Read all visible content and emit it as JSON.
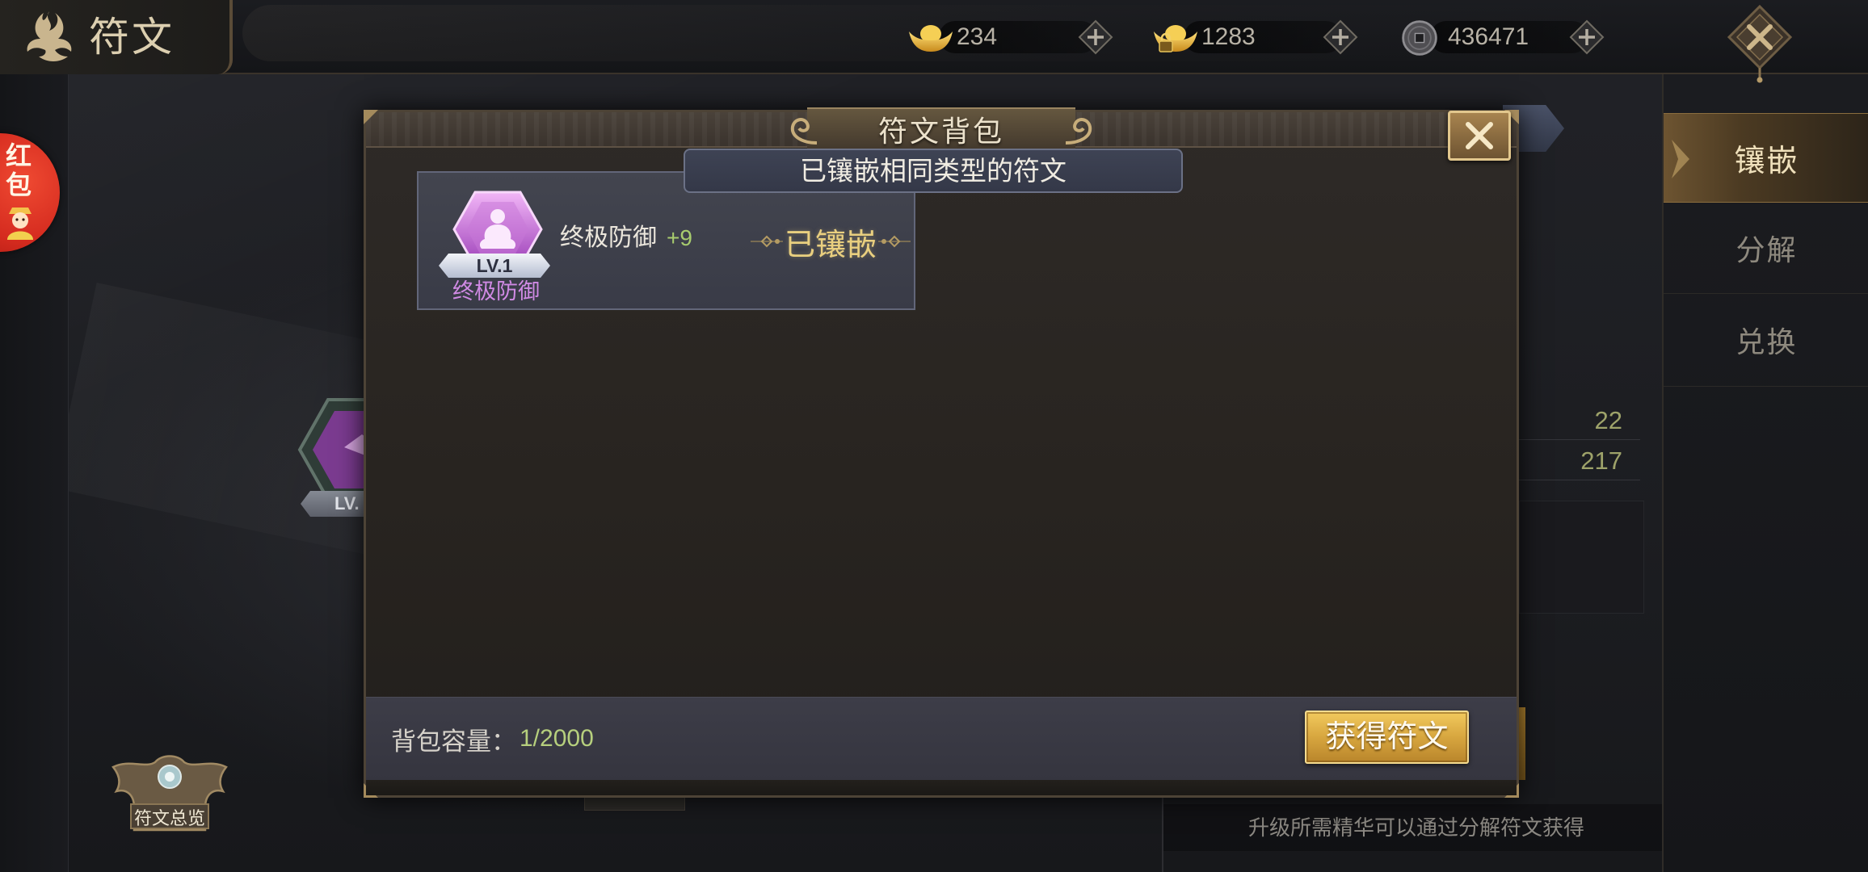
{
  "header": {
    "title": "符文",
    "title_icon": "rune-emblem-icon",
    "currencies": [
      {
        "icon": "gold-ingot-icon",
        "value": "234"
      },
      {
        "icon": "locked-gold-ingot-icon",
        "value": "1283"
      },
      {
        "icon": "copper-coin-icon",
        "value": "436471"
      }
    ],
    "add_icon": "plus-icon",
    "close_icon": "close-x-icon"
  },
  "side_tabs": [
    {
      "label": "镶嵌",
      "active": true
    },
    {
      "label": "分解",
      "active": false
    },
    {
      "label": "兑换",
      "active": false
    }
  ],
  "red_packet": {
    "label": "红包"
  },
  "background": {
    "rune_level": "LV.",
    "stats": [
      "22",
      "217"
    ],
    "overview_button": "符文总览",
    "hint": "升级所需精华可以通过分解符文获得"
  },
  "modal": {
    "title": "符文背包",
    "tooltip": "已镶嵌相同类型的符文",
    "items": [
      {
        "icon": "ultimate-defense-rune-icon",
        "level": "LV.1",
        "type_label": "终极防御",
        "name": "终极防御",
        "bonus": "+9",
        "status": "已镶嵌"
      }
    ],
    "capacity_label": "背包容量：",
    "capacity_value": "1/2000",
    "obtain_button": "获得符文"
  },
  "colors": {
    "gold_text": "#e9cf7f",
    "bonus_green": "#a8cc6e",
    "rune_purple": "#d08ae4",
    "stat_olive": "#9ea36a",
    "red_packet": "#d52b1f",
    "button_gold": "#d7a63f"
  }
}
